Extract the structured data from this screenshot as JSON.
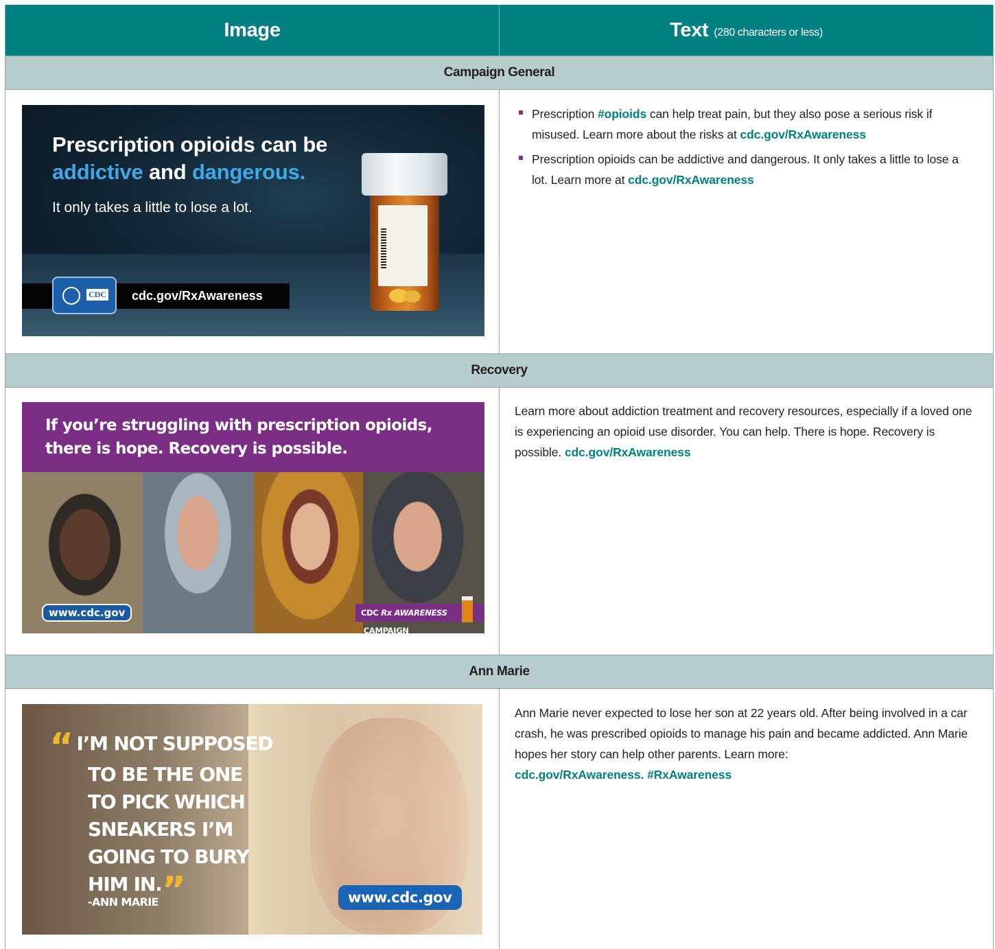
{
  "header": {
    "image_col": "Image",
    "text_col": "Text",
    "text_col_note": "(280 characters or less)"
  },
  "sections": [
    {
      "title": "Campaign General",
      "image": {
        "headline_1": "Prescription opioids can be",
        "headline_2a": "addictive",
        "headline_2b": " and ",
        "headline_2c": "dangerous.",
        "subline": "It only takes a little to lose a lot.",
        "logo_text": "CDC",
        "url": "cdc.gov/RxAwareness"
      },
      "bullets": [
        {
          "pre": "Prescription ",
          "tag": "#opioids",
          "mid": " can help treat pain, but they also pose a serious risk if misused. Learn more about the risks at ",
          "link": "cdc.gov/RxAwareness"
        },
        {
          "pre": "Prescription opioids can be addictive and dangerous. It only takes a little to lose a lot. Learn more at ",
          "link": "cdc.gov/RxAwareness"
        }
      ]
    },
    {
      "title": "Recovery",
      "image": {
        "banner_line1": "If you’re struggling with prescription opioids,",
        "banner_line2": "there is hope. Recovery is possible.",
        "url": "www.cdc.gov",
        "campaign_cdc": "CDC ",
        "campaign_rx": "Rx AWARENESS",
        "campaign_rest": " CAMPAIGN"
      },
      "text": "Learn more about addiction treatment and recovery resources, especially if a loved one is experiencing an opioid use disorder. You can help. There is hope. Recovery is possible. ",
      "link": "cdc.gov/RxAwareness"
    },
    {
      "title": "Ann Marie",
      "image": {
        "quote_lines": [
          "I’M NOT SUPPOSED",
          "TO BE THE ONE",
          "TO PICK WHICH",
          "SNEAKERS I’M",
          "GOING TO BURY",
          "HIM IN."
        ],
        "attribution": "-ANN MARIE",
        "url": "www.cdc.gov"
      },
      "text": "Ann Marie never expected to lose her son at 22 years old. After being involved in a car crash, he was prescribed opioids to manage his pain and became addicted. Ann Marie hopes her story can help other parents. Learn more: ",
      "link": "cdc.gov/RxAwareness",
      "sep": ". ",
      "tag": "#RxAwareness"
    }
  ]
}
